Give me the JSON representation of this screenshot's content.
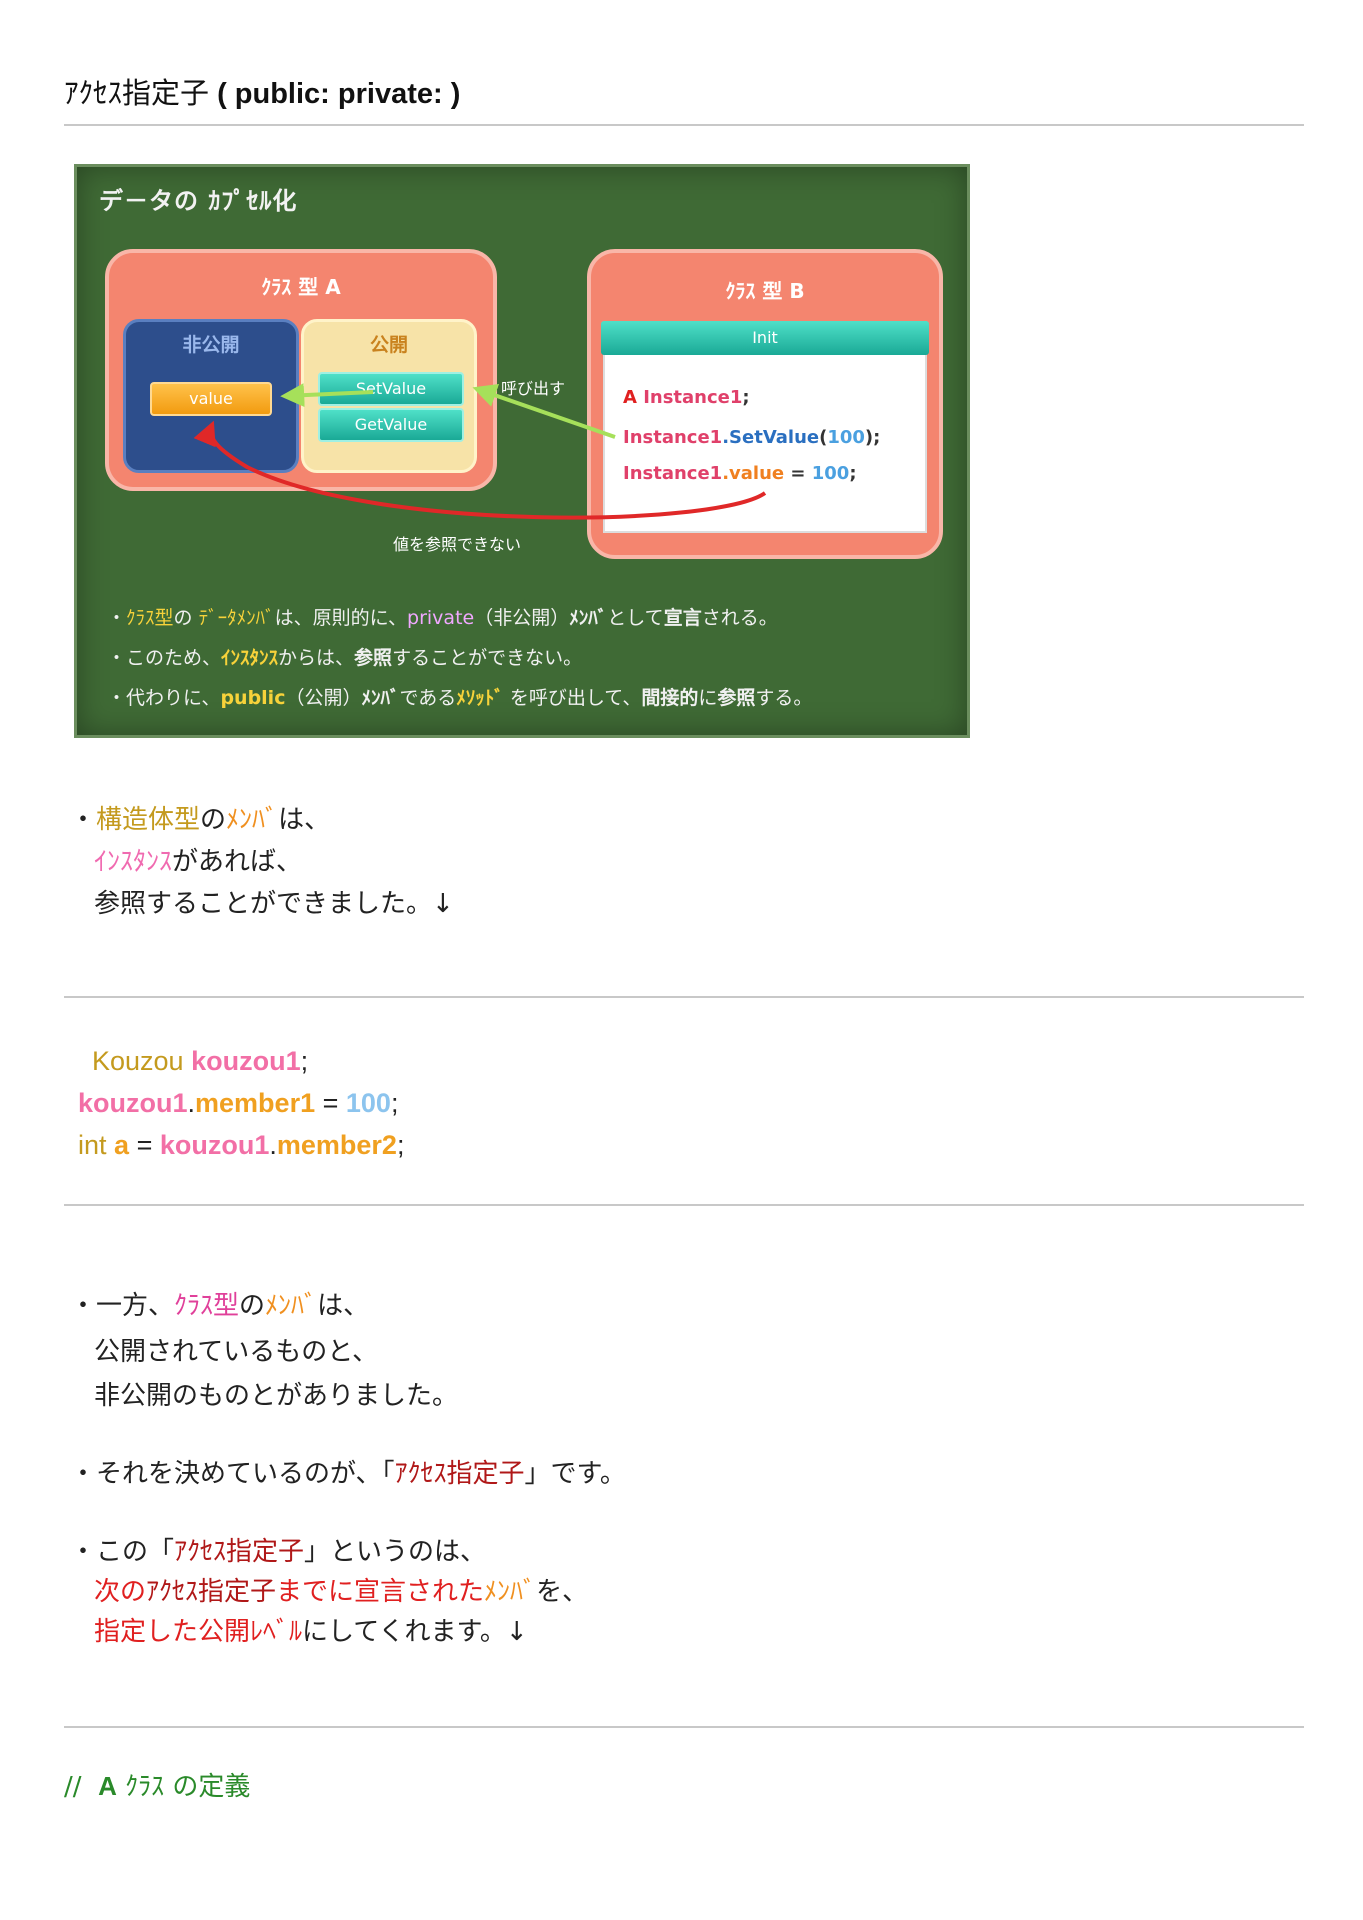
{
  "heading": {
    "jp": "ｱｸｾｽ指定子",
    "en": " ( public: private: )"
  },
  "diagram": {
    "title": "デ－タの ｶﾌﾟｾﾙ化",
    "class_a": {
      "title": "ｸﾗｽ 型  A",
      "private_label": "非公開",
      "public_label": "公開",
      "value": "value",
      "set": "SetValue",
      "get": "GetValue"
    },
    "class_b": {
      "title": "ｸﾗｽ 型  B",
      "init": "Init",
      "line1_a": "A",
      "line1_b": " Instance1",
      "line1_c": ";",
      "line2_a": "Instance1",
      "line2_b": ".SetValue",
      "line2_c": "(",
      "line2_d": "100",
      "line2_e": ");",
      "line3_a": "Instance1",
      "line3_b": ".value",
      "line3_c": " = ",
      "line3_d": "100",
      "line3_e": ";"
    },
    "call_label": "呼び出す",
    "cannot_ref_label": "値を参照できない",
    "notes": [
      [
        "・",
        "ｸﾗｽ型",
        "の ",
        "ﾃﾞｰﾀﾒﾝﾊﾞ",
        "は、原則的に、",
        "private",
        "（非公開）",
        "ﾒﾝﾊﾞ",
        "として",
        "宣言",
        "される。"
      ],
      [
        "・このため、",
        "ｲﾝｽﾀﾝｽ",
        "からは、",
        "参照",
        "することができない。"
      ],
      [
        "・代わりに、",
        "public",
        "（公開）",
        "ﾒﾝﾊﾞ",
        "である",
        "ﾒｿｯﾄﾞ",
        " を呼び出して、",
        "間接的",
        "に",
        "参照",
        "する。"
      ]
    ]
  },
  "para1": {
    "bullet": "・",
    "l1_a": "構造体型",
    "l1_b": "の",
    "l1_c": "ﾒﾝﾊﾞ",
    "l1_d": "は、",
    "l2_a": "ｲﾝｽﾀﾝｽ",
    "l2_b": "があれば、",
    "l3": "参照することができました。↓"
  },
  "code1": {
    "l1_type": "Kouzou ",
    "l1_var": "kouzou1",
    "l1_end": ";",
    "l2_var": "kouzou1",
    "l2_dot": ".",
    "l2_mem": "member1",
    "l2_eq": " = ",
    "l2_num": "100",
    "l2_end": ";",
    "l3_type": "int ",
    "l3_a": "a",
    "l3_eq": " = ",
    "l3_var": "kouzou1",
    "l3_dot": ".",
    "l3_mem": "member2",
    "l3_end": ";"
  },
  "para2": {
    "l1_a": "・一方、",
    "l1_b": "ｸﾗｽ型",
    "l1_c": "の",
    "l1_d": "ﾒﾝﾊﾞ",
    "l1_e": "は、",
    "l2": "公開されているものと、",
    "l3": "非公開のものとがありました。",
    "l4_a": "・それを決めているのが、「",
    "l4_b": "ｱｸｾｽ指定子",
    "l4_c": "」です。",
    "l5_a": "・この「",
    "l5_b": "ｱｸｾｽ指定子",
    "l5_c": "」というのは、",
    "l6_a": "次の",
    "l6_b": "ｱｸｾｽ指定子",
    "l6_c": "までに宣言された",
    "l6_d": "ﾒﾝﾊﾞ",
    "l6_e": "を、",
    "l7_a": "指定した公開ﾚﾍﾞﾙ",
    "l7_b": "にしてくれます。↓"
  },
  "comment": {
    "slashes": "//",
    "a": "A",
    "rest": " ｸﾗｽ の定義"
  }
}
